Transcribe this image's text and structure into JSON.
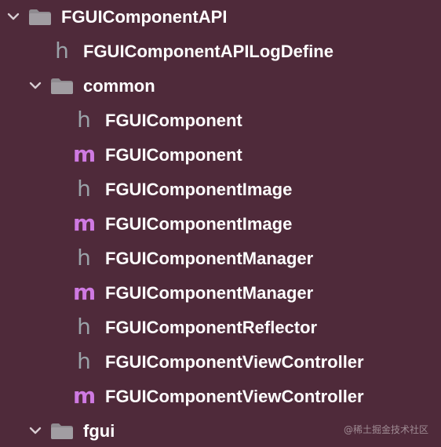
{
  "tree": {
    "root_folder": {
      "label": "FGUIComponentAPI",
      "expanded": true,
      "icon": "folder-icon"
    },
    "log_define": {
      "label": "FGUIComponentAPILogDefine",
      "icon": "h",
      "icon_name": "header-file-icon"
    },
    "common_folder": {
      "label": "common",
      "expanded": true,
      "icon": "folder-icon"
    },
    "common_files": [
      {
        "label": "FGUIComponent",
        "icon": "h",
        "icon_name": "header-file-icon"
      },
      {
        "label": "FGUIComponent",
        "icon": "m",
        "icon_name": "implementation-file-icon"
      },
      {
        "label": "FGUIComponentImage",
        "icon": "h",
        "icon_name": "header-file-icon"
      },
      {
        "label": "FGUIComponentImage",
        "icon": "m",
        "icon_name": "implementation-file-icon"
      },
      {
        "label": "FGUIComponentManager",
        "icon": "h",
        "icon_name": "header-file-icon"
      },
      {
        "label": "FGUIComponentManager",
        "icon": "m",
        "icon_name": "implementation-file-icon"
      },
      {
        "label": "FGUIComponentReflector",
        "icon": "h",
        "icon_name": "header-file-icon"
      },
      {
        "label": "FGUIComponentViewController",
        "icon": "h",
        "icon_name": "header-file-icon"
      },
      {
        "label": "FGUIComponentViewController",
        "icon": "m",
        "icon_name": "implementation-file-icon"
      }
    ],
    "fgui_folder": {
      "label": "fgui",
      "expanded": true,
      "icon": "folder-icon"
    }
  },
  "watermark": "@稀土掘金技术社区",
  "colors": {
    "background": "#4f2a3a",
    "text": "#ffffff",
    "folder": "#8f8b90",
    "header_icon": "#9aa2a8",
    "implementation_icon": "#cf7ae2"
  }
}
